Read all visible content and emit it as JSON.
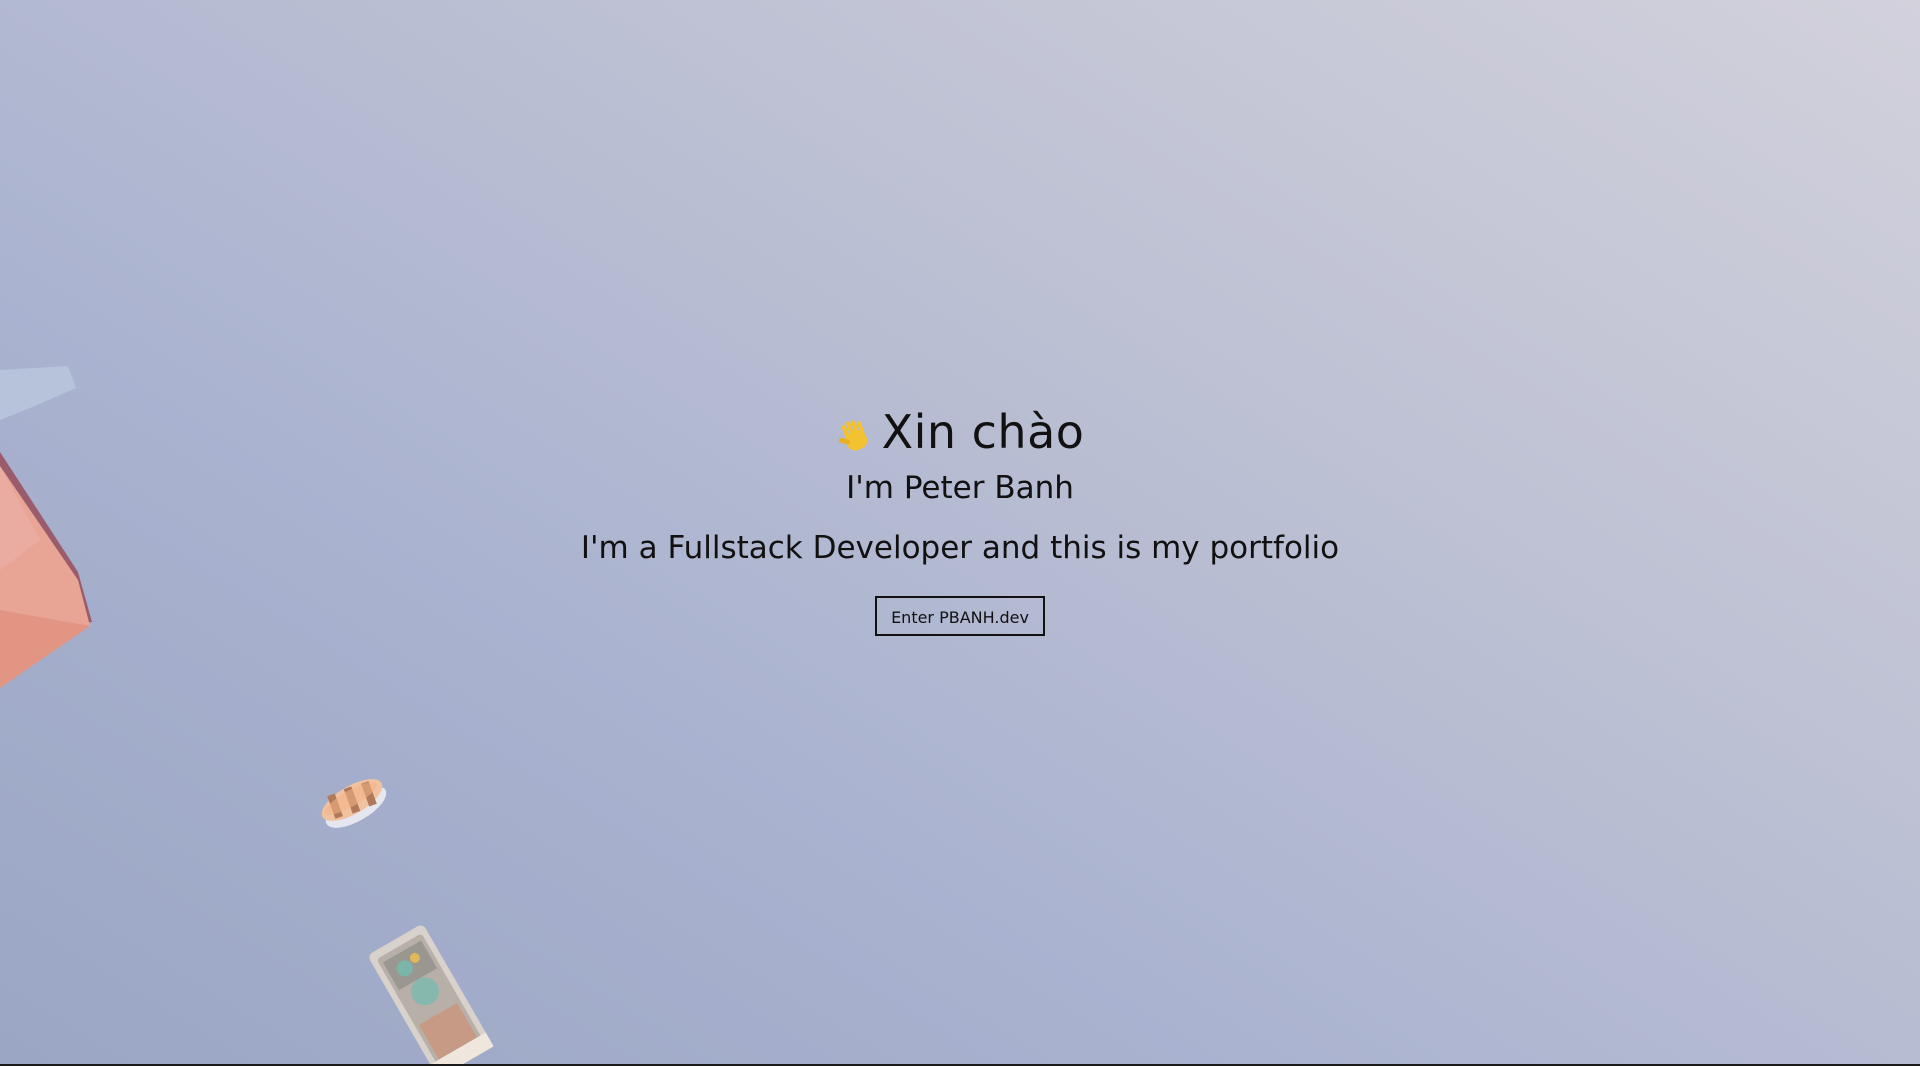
{
  "hero": {
    "greeting": "Xin chào",
    "name_line": "I'm Peter Banh",
    "role_line": "I'm a Fullstack Developer and this is my portfolio",
    "enter_label": "Enter PBANH.dev"
  },
  "icons": {
    "wave": "waving-hand-icon"
  },
  "colors": {
    "text": "#111111",
    "wave": "#f2c230"
  }
}
